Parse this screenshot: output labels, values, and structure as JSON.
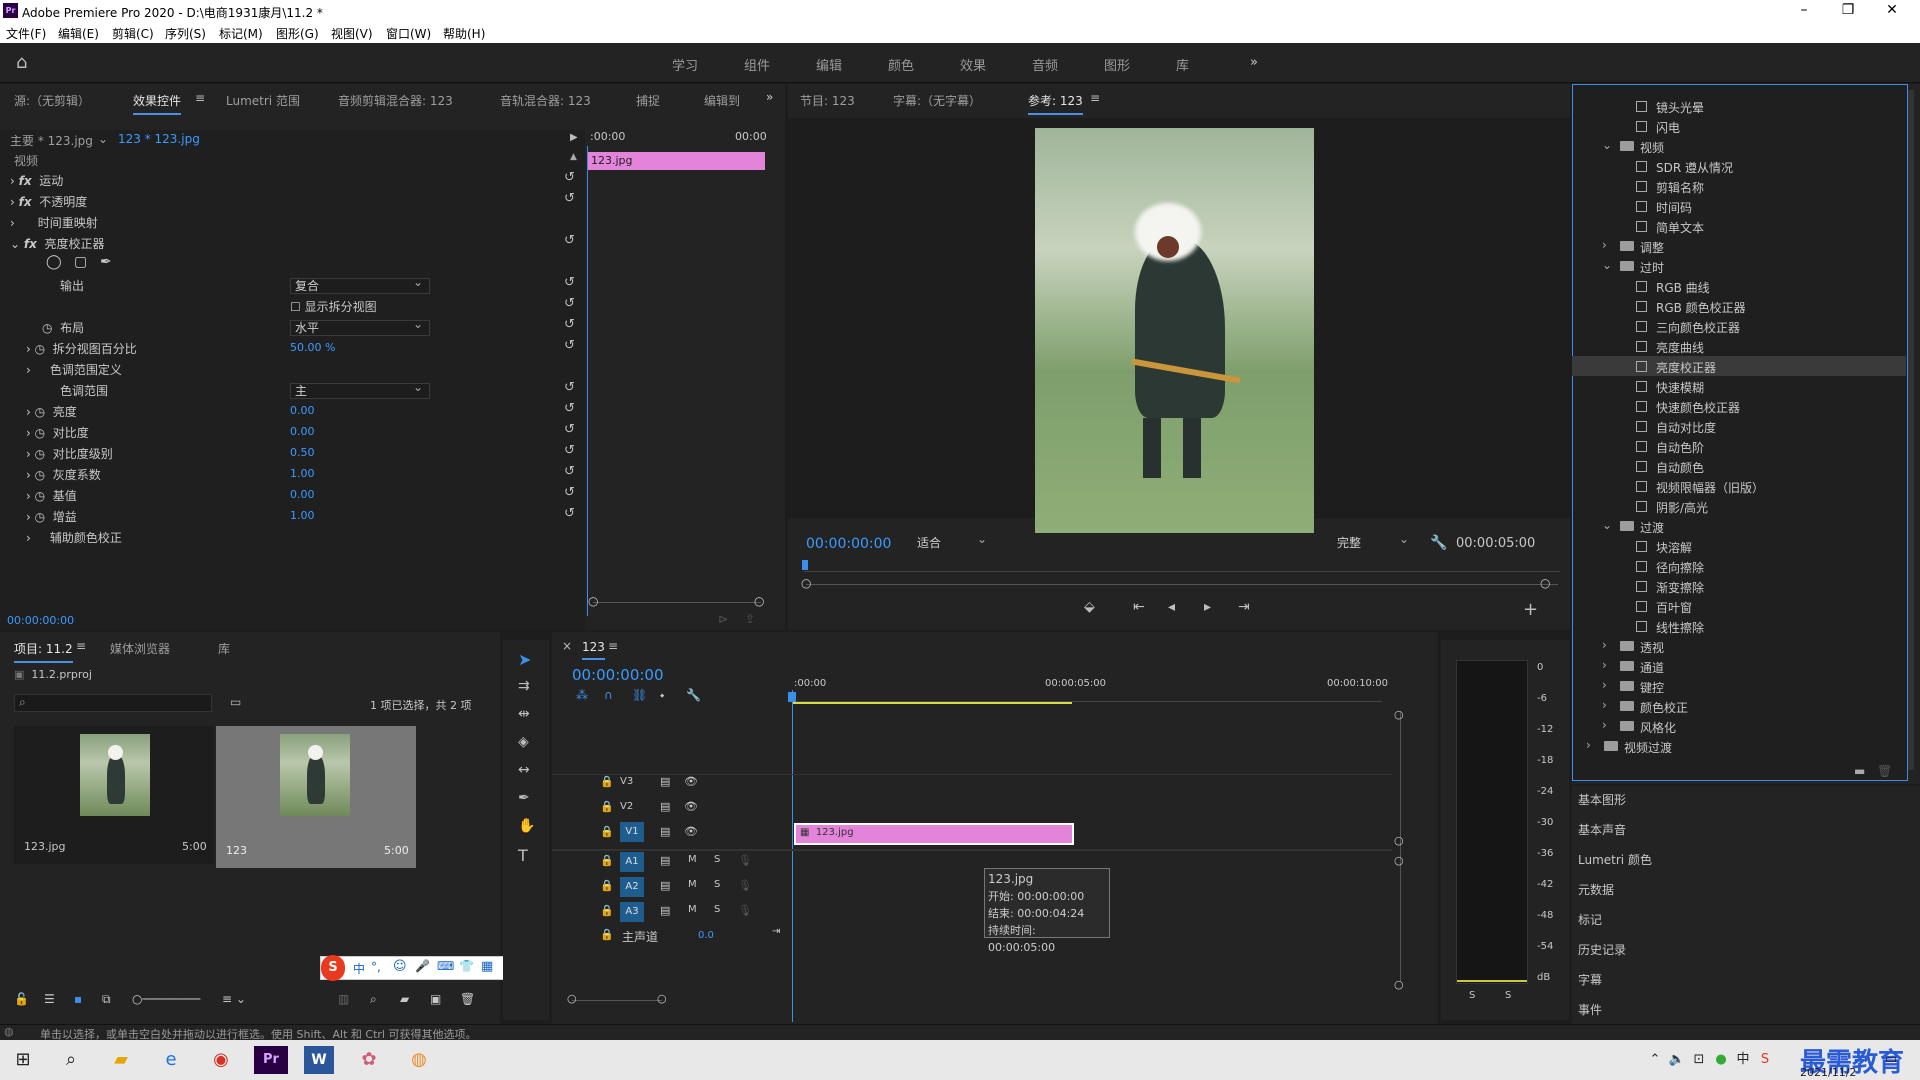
{
  "window": {
    "title": "Adobe Premiere Pro 2020 - D:\\电商1931康月\\11.2 *",
    "app_icon": "Pr"
  },
  "menu": [
    "文件(F)",
    "编辑(E)",
    "剪辑(C)",
    "序列(S)",
    "标记(M)",
    "图形(G)",
    "视图(V)",
    "窗口(W)",
    "帮助(H)"
  ],
  "workspaces": [
    "学习",
    "组件",
    "编辑",
    "颜色",
    "效果",
    "音频",
    "图形",
    "库"
  ],
  "source_panel": {
    "tabs": [
      "源:（无剪辑）",
      "效果控件",
      "Lumetri 范围",
      "音频剪辑混合器: 123",
      "音轨混合器: 123",
      "捕捉",
      "编辑到"
    ],
    "master": "主要 * 123.jpg",
    "clip": "123 * 123.jpg",
    "time_start": ":00:00",
    "time_end": "00:00",
    "clip_bar_label": "123.jpg",
    "section": "视频",
    "fx": [
      "运动",
      "不透明度",
      "时间重映射",
      "亮度校正器"
    ],
    "output_label": "输出",
    "output_value": "复合",
    "split_view_label": "显示拆分视图",
    "layout_label": "布局",
    "layout_value": "水平",
    "split_percent_label": "拆分视图百分比",
    "split_percent_value": "50.00 %",
    "tonal_def_label": "色调范围定义",
    "tonal_range_label": "色调范围",
    "tonal_range_value": "主",
    "params": [
      {
        "label": "亮度",
        "value": "0.00"
      },
      {
        "label": "对比度",
        "value": "0.00"
      },
      {
        "label": "对比度级别",
        "value": "0.50"
      },
      {
        "label": "灰度系数",
        "value": "1.00"
      },
      {
        "label": "基值",
        "value": "0.00"
      },
      {
        "label": "增益",
        "value": "1.00"
      }
    ],
    "secondary_label": "辅助颜色校正",
    "timecode": "00:00:00:00"
  },
  "program_panel": {
    "tabs": [
      "节目: 123",
      "字幕:（无字幕）",
      "参考: 123"
    ],
    "timecode": "00:00:00:00",
    "fit": "适合",
    "quality": "完整",
    "duration": "00:00:05:00"
  },
  "effects_tree": [
    {
      "label": "镜头光晕",
      "kind": "file",
      "indent": 2
    },
    {
      "label": "闪电",
      "kind": "file",
      "indent": 2
    },
    {
      "label": "视频",
      "kind": "folder-open",
      "indent": 1
    },
    {
      "label": "SDR 遵从情况",
      "kind": "file",
      "indent": 2
    },
    {
      "label": "剪辑名称",
      "kind": "file",
      "indent": 2
    },
    {
      "label": "时间码",
      "kind": "file",
      "indent": 2
    },
    {
      "label": "简单文本",
      "kind": "file",
      "indent": 2
    },
    {
      "label": "调整",
      "kind": "folder",
      "indent": 1
    },
    {
      "label": "过时",
      "kind": "folder-open",
      "indent": 1
    },
    {
      "label": "RGB 曲线",
      "kind": "file",
      "indent": 2
    },
    {
      "label": "RGB 颜色校正器",
      "kind": "file",
      "indent": 2
    },
    {
      "label": "三向颜色校正器",
      "kind": "file",
      "indent": 2
    },
    {
      "label": "亮度曲线",
      "kind": "file",
      "indent": 2
    },
    {
      "label": "亮度校正器",
      "kind": "file",
      "indent": 2,
      "selected": true
    },
    {
      "label": "快速模糊",
      "kind": "file",
      "indent": 2
    },
    {
      "label": "快速颜色校正器",
      "kind": "file",
      "indent": 2
    },
    {
      "label": "自动对比度",
      "kind": "file",
      "indent": 2
    },
    {
      "label": "自动色阶",
      "kind": "file",
      "indent": 2
    },
    {
      "label": "自动颜色",
      "kind": "file",
      "indent": 2
    },
    {
      "label": "视频限幅器（旧版）",
      "kind": "file",
      "indent": 2
    },
    {
      "label": "阴影/高光",
      "kind": "file",
      "indent": 2
    },
    {
      "label": "过渡",
      "kind": "folder-open",
      "indent": 1
    },
    {
      "label": "块溶解",
      "kind": "file",
      "indent": 2
    },
    {
      "label": "径向擦除",
      "kind": "file",
      "indent": 2
    },
    {
      "label": "渐变擦除",
      "kind": "file",
      "indent": 2
    },
    {
      "label": "百叶窗",
      "kind": "file",
      "indent": 2
    },
    {
      "label": "线性擦除",
      "kind": "file",
      "indent": 2
    },
    {
      "label": "透视",
      "kind": "folder",
      "indent": 1
    },
    {
      "label": "通道",
      "kind": "folder",
      "indent": 1
    },
    {
      "label": "键控",
      "kind": "folder",
      "indent": 1
    },
    {
      "label": "颜色校正",
      "kind": "folder",
      "indent": 1
    },
    {
      "label": "风格化",
      "kind": "folder",
      "indent": 1
    },
    {
      "label": "视频过渡",
      "kind": "folder",
      "indent": 0
    }
  ],
  "side_panels": [
    "基本图形",
    "基本声音",
    "Lumetri 颜色",
    "元数据",
    "标记",
    "历史记录",
    "字幕",
    "事件"
  ],
  "project_panel": {
    "tabs": [
      "项目: 11.2",
      "媒体浏览器",
      "库"
    ],
    "file": "11.2.prproj",
    "selection": "1 项已选择，共 2 项",
    "items": [
      {
        "name": "123.jpg",
        "duration": "5:00"
      },
      {
        "name": "123",
        "duration": "5:00"
      }
    ]
  },
  "timeline": {
    "seq": "123",
    "timecode": "00:00:00:00",
    "ruler": [
      ":00:00",
      "00:00:05:00",
      "00:00:10:00"
    ],
    "video_tracks": [
      "V3",
      "V2",
      "V1"
    ],
    "audio_tracks": [
      "A1",
      "A2",
      "A3"
    ],
    "master": "主声道",
    "master_value": "0.0",
    "clip": "123.jpg",
    "tooltip": [
      "123.jpg",
      "开始: 00:00:00:00",
      "结束: 00:00:04:24",
      "持续时间: 00:00:05:00"
    ]
  },
  "meter_scale": [
    "0",
    "-6",
    "-12",
    "-18",
    "-24",
    "-30",
    "-36",
    "-42",
    "-48",
    "-54",
    "dB"
  ],
  "meter_buttons": [
    "S",
    "S"
  ],
  "status_bar": "单击以选择，或单击空白处并拖动以进行框选。使用 Shift、Alt 和 Ctrl 可获得其他选项。",
  "ime": [
    "中",
    "°,",
    "☺",
    "🎤",
    "⌨",
    "👕",
    "▦"
  ],
  "tray": {
    "time": "2021/11/2",
    "watermark": "最需教育"
  }
}
